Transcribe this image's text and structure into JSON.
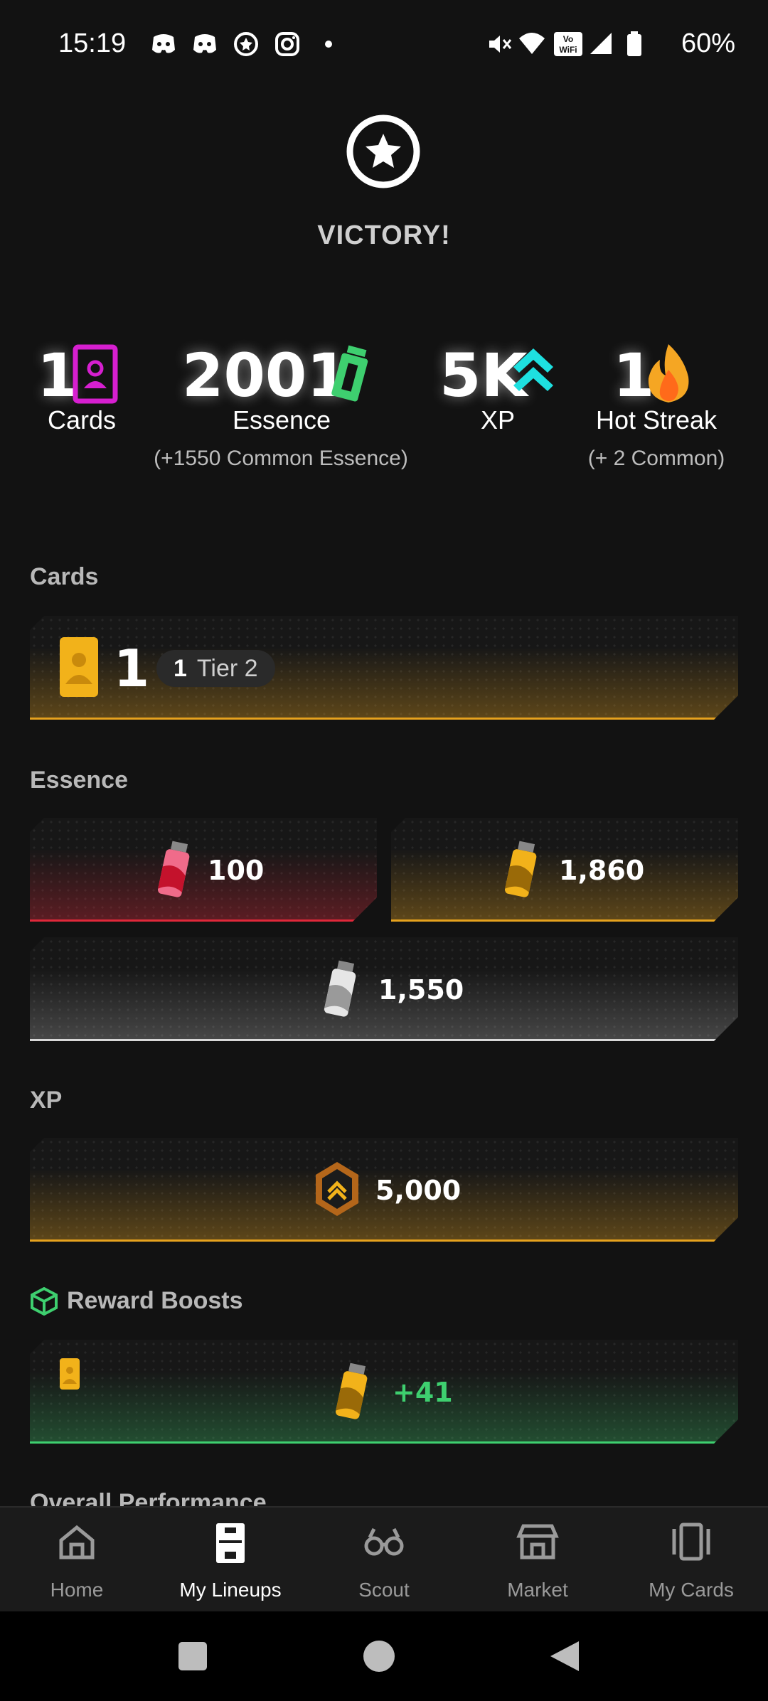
{
  "status_bar": {
    "time": "15:19",
    "battery": "60%"
  },
  "header": {
    "title": "VICTORY!"
  },
  "summary": {
    "cards": {
      "value": "1",
      "label": "Cards"
    },
    "essence": {
      "value": "2001",
      "label": "Essence",
      "sub": "(+1550 Common Essence)"
    },
    "xp": {
      "value": "5K",
      "label": "XP"
    },
    "hot_streak": {
      "value": "1",
      "label": "Hot Streak",
      "sub": "(+ 2 Common)"
    }
  },
  "cards_section": {
    "title": "Cards",
    "count": "1",
    "tier_count": "1",
    "tier_label": "Tier 2"
  },
  "essence_section": {
    "title": "Essence",
    "items": [
      {
        "value": "100",
        "color": "#e0283a"
      },
      {
        "value": "1,860",
        "color": "#e6a21e"
      },
      {
        "value": "1,550",
        "color": "#d8d8d8"
      }
    ]
  },
  "xp_section": {
    "title": "XP",
    "value": "5,000"
  },
  "boosts_section": {
    "title": "Reward Boosts",
    "value": "+41"
  },
  "next_section": {
    "title": "Overall Performance"
  },
  "nav": {
    "items": [
      {
        "label": "Home",
        "icon": "home-icon"
      },
      {
        "label": "My Lineups",
        "icon": "lineups-icon",
        "active": true
      },
      {
        "label": "Scout",
        "icon": "binoculars-icon"
      },
      {
        "label": "Market",
        "icon": "store-icon"
      },
      {
        "label": "My Cards",
        "icon": "cards-icon"
      }
    ]
  },
  "colors": {
    "accent_gold": "#e6a21e",
    "accent_red": "#e0283a",
    "accent_green": "#3ecf6f",
    "accent_cyan": "#1ee0e0",
    "accent_magenta": "#d61fd0"
  }
}
